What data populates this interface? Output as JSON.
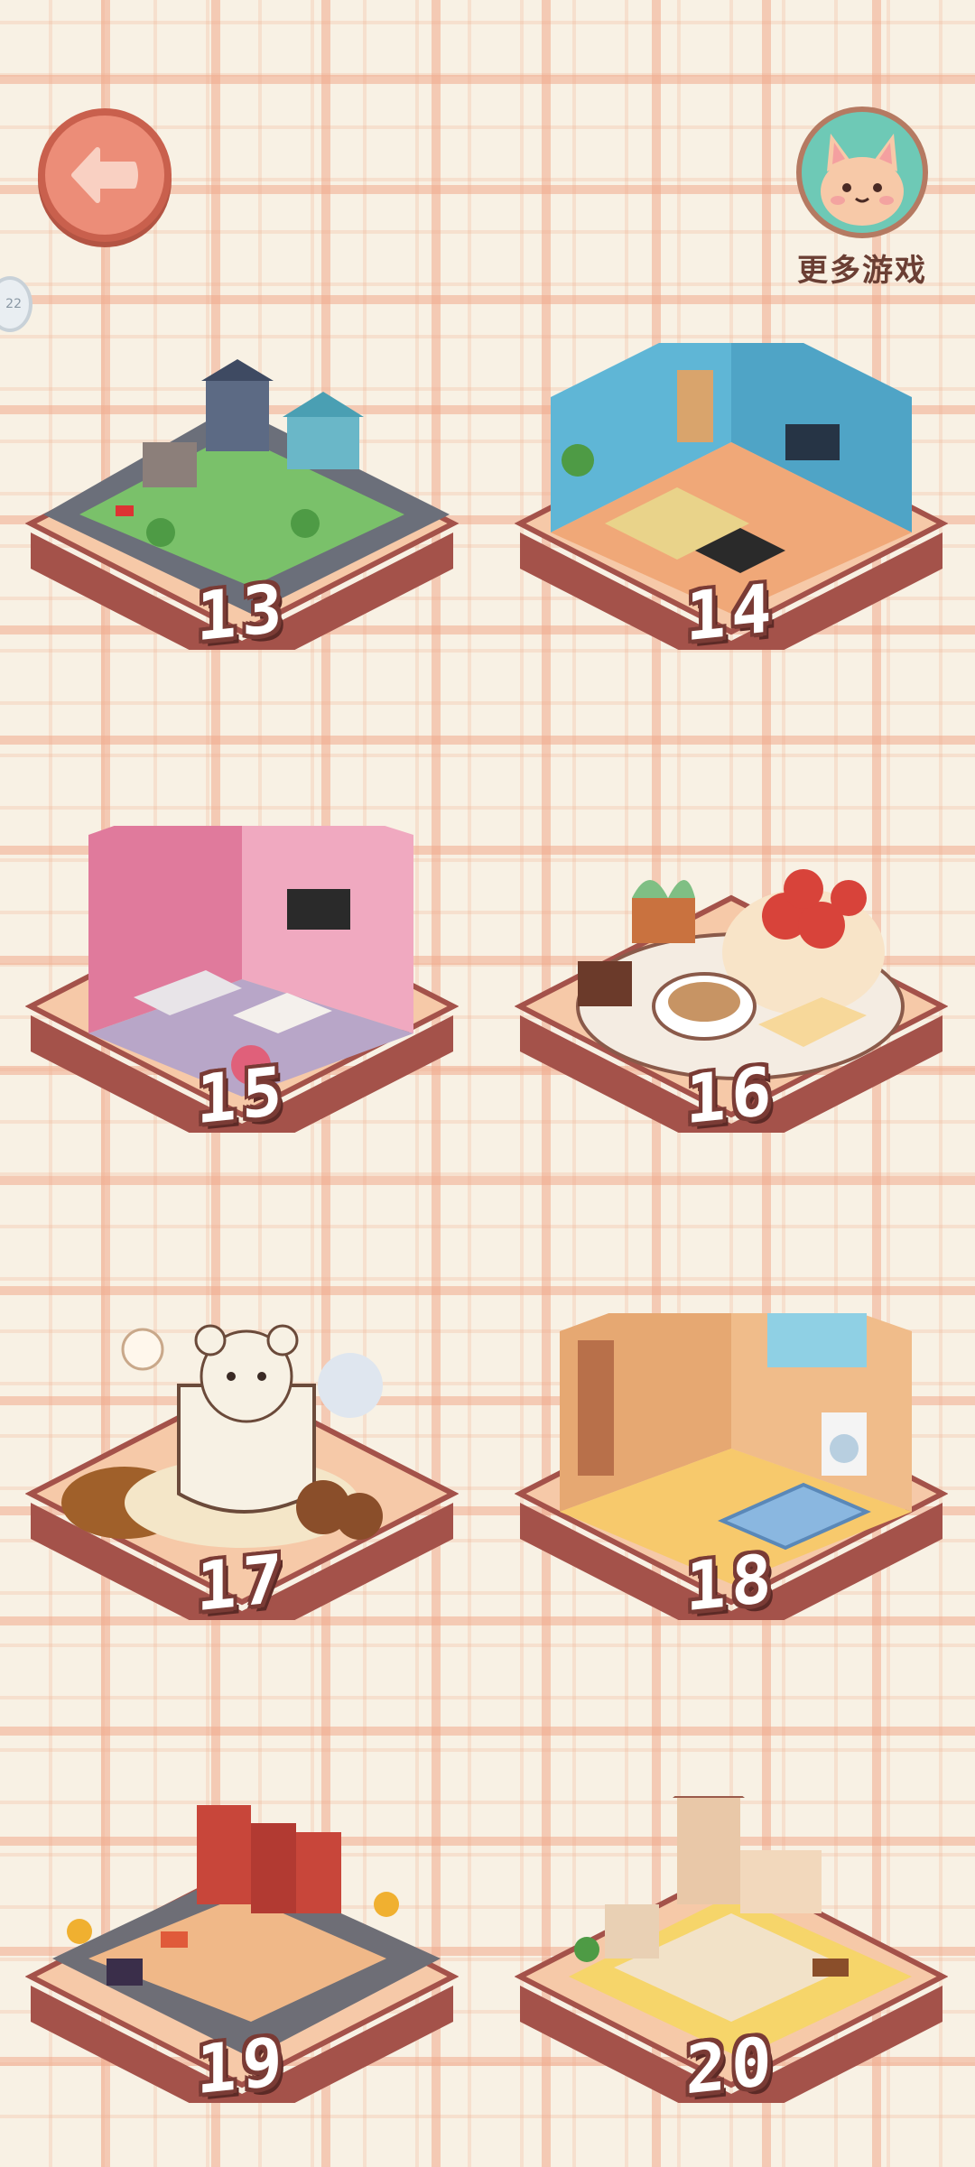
{
  "header": {
    "back_icon": "back-arrow-icon",
    "side_badge": "22",
    "more_games": {
      "label": "更多游戏",
      "icon": "cat-avatar-icon"
    }
  },
  "levels": [
    {
      "number": "13",
      "scene": "city-neighborhood"
    },
    {
      "number": "14",
      "scene": "blue-living-room"
    },
    {
      "number": "15",
      "scene": "pink-living-room"
    },
    {
      "number": "16",
      "scene": "strawberry-cake-coffee"
    },
    {
      "number": "17",
      "scene": "bear-coffee-cup"
    },
    {
      "number": "18",
      "scene": "bathroom-kitchen"
    },
    {
      "number": "19",
      "scene": "red-brick-street"
    },
    {
      "number": "20",
      "scene": "two-story-house"
    }
  ],
  "colors": {
    "background": "#f8f1e4",
    "grid_line": "#f0aa8c",
    "platform_top": "#f6c9a8",
    "platform_side": "#a4524a",
    "number_outline": "#7a3b35"
  }
}
